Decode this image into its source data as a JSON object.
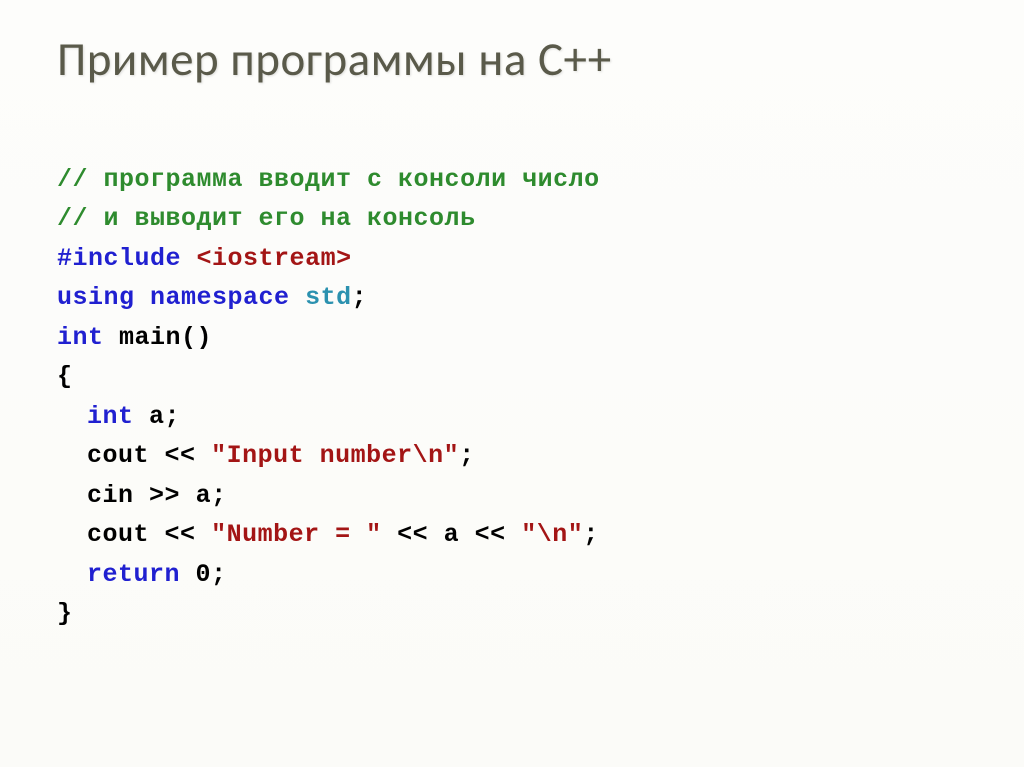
{
  "title": "Пример программы на C++",
  "code": {
    "c1": "// программа вводит с консоли число",
    "c2": "// и выводит его на консоль",
    "inc_kw": "#include",
    "inc_hdr": "<iostream>",
    "using_kw": "using",
    "ns_kw": "namespace",
    "std_id": "std",
    "semi": ";",
    "int_t": "int",
    "main_id": "main",
    "parens": "()",
    "lbrace": "{",
    "rbrace": "}",
    "a_id": "a",
    "cout_id": "cout",
    "cin_id": "cin",
    "lt2": "<<",
    "gt2": ">>",
    "str_input": "\"Input number\\n\"",
    "str_numeq": "\"Number = \"",
    "str_nl": "\"\\n\"",
    "return_kw": "return",
    "zero": "0"
  }
}
